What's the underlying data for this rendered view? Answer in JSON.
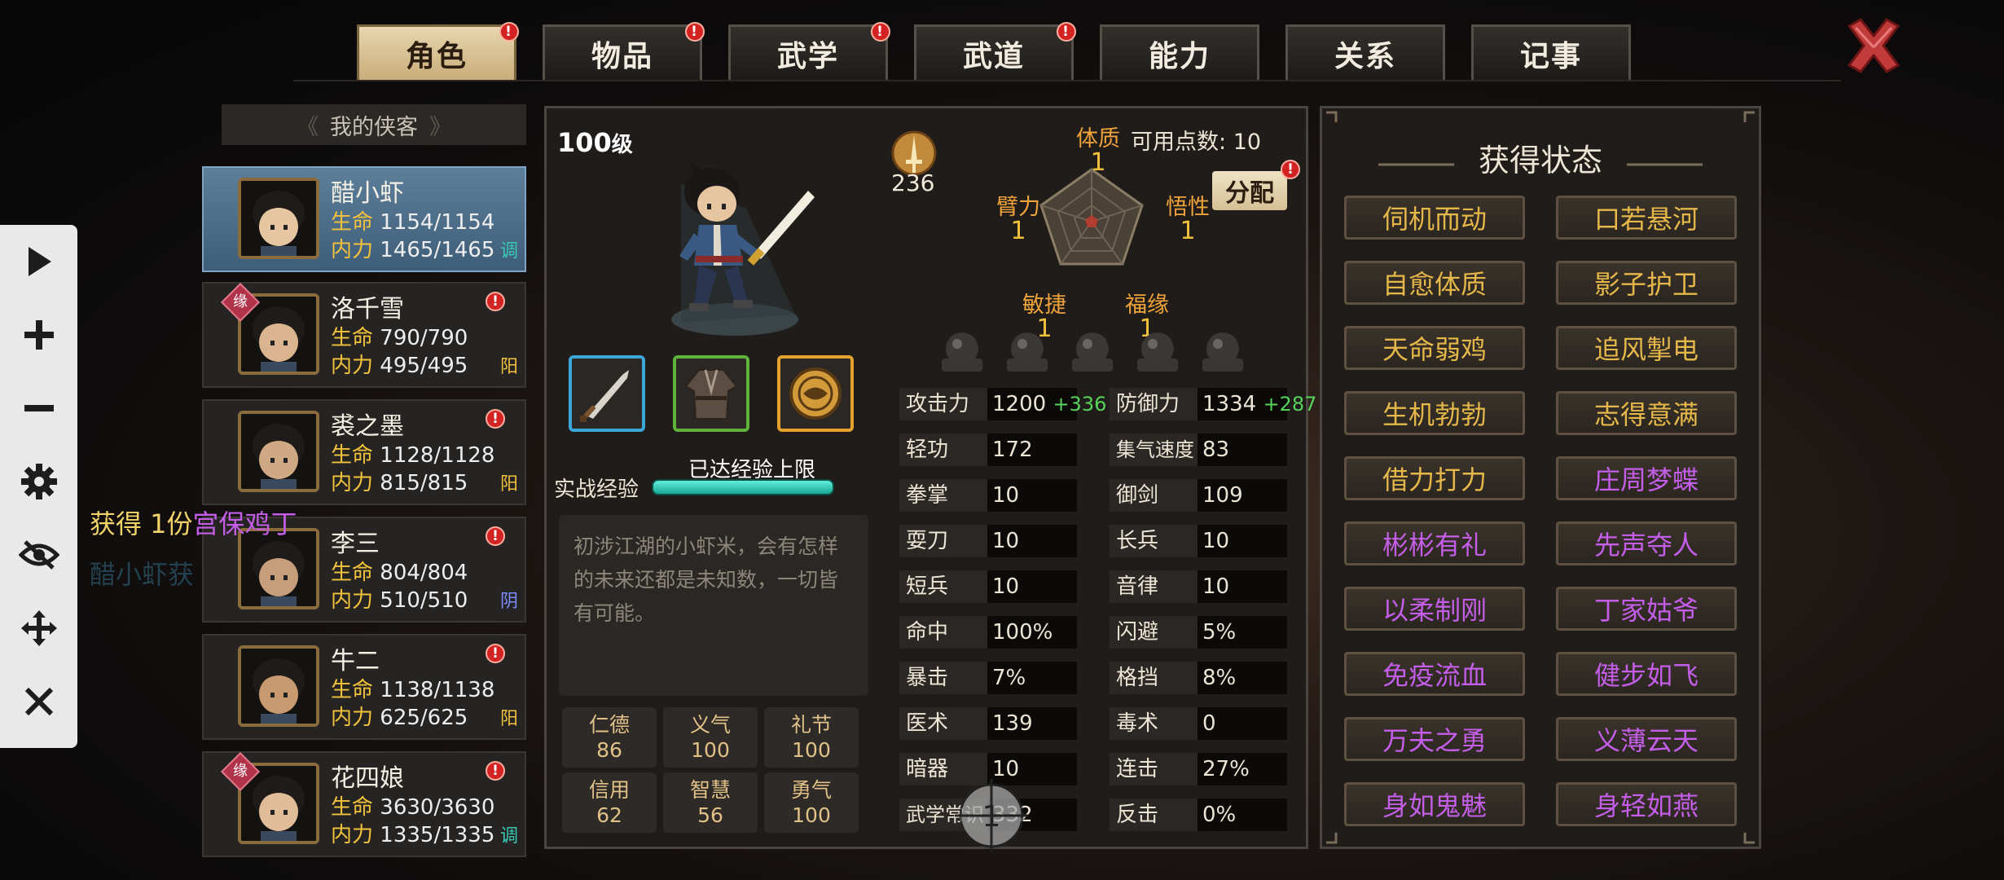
{
  "tabs": [
    {
      "label": "角色",
      "badge": "!",
      "active": true
    },
    {
      "label": "物品",
      "badge": "!"
    },
    {
      "label": "武学",
      "badge": "!"
    },
    {
      "label": "武道",
      "badge": "!"
    },
    {
      "label": "能力"
    },
    {
      "label": "关系"
    },
    {
      "label": "记事"
    }
  ],
  "roster": {
    "header": "我的侠客",
    "life_label": "生命",
    "mp_label": "内力",
    "badge": "!",
    "yuan": "缘",
    "members": [
      {
        "name": "醋小虾",
        "hp": "1154/1154",
        "mp": "1465/1465",
        "tag": "调",
        "tag_color": "#39c8b4"
      },
      {
        "name": "洛千雪",
        "hp": "790/790",
        "mp": "495/495",
        "tag": "阳",
        "tag_color": "#f3c23c"
      },
      {
        "name": "裘之墨",
        "hp": "1128/1128",
        "mp": "815/815",
        "tag": "阳",
        "tag_color": "#f3c23c"
      },
      {
        "name": "李三",
        "hp": "804/804",
        "mp": "510/510",
        "tag": "阴",
        "tag_color": "#7a8cff"
      },
      {
        "name": "牛二",
        "hp": "1138/1138",
        "mp": "625/625",
        "tag": "阳",
        "tag_color": "#f3c23c"
      },
      {
        "name": "花四娘",
        "hp": "3630/3630",
        "mp": "1335/1335",
        "tag": "调",
        "tag_color": "#39c8b4"
      }
    ]
  },
  "toast": {
    "prefix": "获得 1份",
    "item": "宫保鸡丁",
    "line2": "醋小虾获"
  },
  "character": {
    "level": "100",
    "level_unit": "级",
    "power": "236",
    "exp_label": "实战经验",
    "exp_status": "已达经验上限",
    "exp_fraction": 1.0,
    "description": "初涉江湖的小虾米，会有怎样的未来还都是未知数，一切皆有可能。",
    "virtues": [
      {
        "name": "仁德",
        "value": "86"
      },
      {
        "name": "义气",
        "value": "100"
      },
      {
        "name": "礼节",
        "value": "100"
      },
      {
        "name": "信用",
        "value": "62"
      },
      {
        "name": "智慧",
        "value": "56"
      },
      {
        "name": "勇气",
        "value": "100"
      }
    ]
  },
  "attributes": {
    "available_label": "可用点数:",
    "available": "10",
    "allocate_label": "分配",
    "badge": "!",
    "items": [
      {
        "name": "体质",
        "value": "1"
      },
      {
        "name": "悟性",
        "value": "1"
      },
      {
        "name": "福缘",
        "value": "1"
      },
      {
        "name": "敏捷",
        "value": "1"
      },
      {
        "name": "臂力",
        "value": "1"
      }
    ]
  },
  "stats_left": [
    {
      "k": "攻击力",
      "v": "1200",
      "plus": "+336"
    },
    {
      "k": "轻功",
      "v": "172"
    },
    {
      "k": "拳掌",
      "v": "10"
    },
    {
      "k": "耍刀",
      "v": "10"
    },
    {
      "k": "短兵",
      "v": "10"
    },
    {
      "k": "命中",
      "v": "100%"
    },
    {
      "k": "暴击",
      "v": "7%"
    },
    {
      "k": "医术",
      "v": "139"
    },
    {
      "k": "暗器",
      "v": "10"
    },
    {
      "k": "武学常识",
      "v": "332"
    }
  ],
  "stats_right": [
    {
      "k": "防御力",
      "v": "1334",
      "plus": "+287"
    },
    {
      "k": "集气速度",
      "v": "83"
    },
    {
      "k": "御剑",
      "v": "109"
    },
    {
      "k": "长兵",
      "v": "10"
    },
    {
      "k": "音律",
      "v": "10"
    },
    {
      "k": "闪避",
      "v": "5%"
    },
    {
      "k": "格挡",
      "v": "8%"
    },
    {
      "k": "毒术",
      "v": "0"
    },
    {
      "k": "连击",
      "v": "27%"
    },
    {
      "k": "反击",
      "v": "0%"
    }
  ],
  "status": {
    "title": "获得状态",
    "items": [
      {
        "label": "伺机而动",
        "color": "#e6b84a"
      },
      {
        "label": "口若悬河",
        "color": "#e6b84a"
      },
      {
        "label": "自愈体质",
        "color": "#e6b84a"
      },
      {
        "label": "影子护卫",
        "color": "#e6b84a"
      },
      {
        "label": "天命弱鸡",
        "color": "#e6b84a"
      },
      {
        "label": "追风掣电",
        "color": "#e6b84a"
      },
      {
        "label": "生机勃勃",
        "color": "#e6b84a"
      },
      {
        "label": "志得意满",
        "color": "#e6b84a"
      },
      {
        "label": "借力打力",
        "color": "#e6b84a"
      },
      {
        "label": "庄周梦蝶",
        "color": "#c45ee8"
      },
      {
        "label": "彬彬有礼",
        "color": "#c45ee8"
      },
      {
        "label": "先声夺人",
        "color": "#c45ee8"
      },
      {
        "label": "以柔制刚",
        "color": "#c45ee8"
      },
      {
        "label": "丁家姑爷",
        "color": "#c45ee8"
      },
      {
        "label": "免疫流血",
        "color": "#c45ee8"
      },
      {
        "label": "健步如飞",
        "color": "#c45ee8"
      },
      {
        "label": "万夫之勇",
        "color": "#c45ee8"
      },
      {
        "label": "义薄云天",
        "color": "#c45ee8"
      },
      {
        "label": "身如鬼魅",
        "color": "#c45ee8"
      },
      {
        "label": "身轻如燕",
        "color": "#c45ee8"
      }
    ]
  },
  "toolbar": [
    "play-icon",
    "plus-icon",
    "minus-icon",
    "gear-icon",
    "eye-off-icon",
    "move-icon",
    "close-icon"
  ],
  "colors": {
    "accent_gold": "#e6b84a",
    "rare_purple": "#c45ee8",
    "hp_label": "#f3c23c"
  },
  "overlay_text": "1"
}
